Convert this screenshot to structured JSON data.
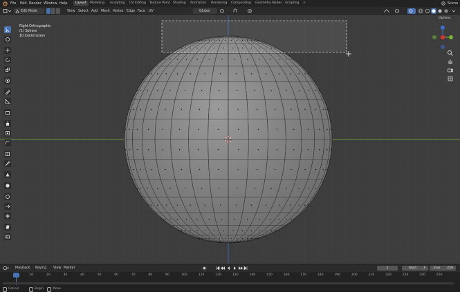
{
  "menu": {
    "items": [
      "File",
      "Edit",
      "Render",
      "Window",
      "Help"
    ]
  },
  "workspaces": {
    "tabs": [
      "Layout",
      "Modeling",
      "Sculpting",
      "UV Editing",
      "Texture Paint",
      "Shading",
      "Animation",
      "Rendering",
      "Compositing",
      "Geometry Nodes",
      "Scripting"
    ],
    "active": "Layout",
    "add": "+",
    "scene": "Scene"
  },
  "editor_header": {
    "mode": "Edit Mode",
    "view": "View",
    "select": "Select",
    "add": "Add",
    "mesh": "Mesh",
    "vertex": "Vertex",
    "edge": "Edge",
    "face": "Face",
    "uv": "UV",
    "transform_orientation": "Global",
    "options": "Options"
  },
  "viewport": {
    "view_name": "Right Orthographic",
    "object": "(1) Sphere",
    "scale": "10 Centimeters",
    "colors": {
      "background": "#3d3d3d",
      "mesh": "#8a8a8a",
      "x_axis": "#79b33a",
      "z_axis": "#3b6fc9"
    }
  },
  "timeline": {
    "playback": "Playback",
    "keying": "Keying",
    "view": "View",
    "marker": "Marker",
    "current_frame": "1",
    "start_label": "Start",
    "start": "1",
    "end_label": "End",
    "end": "250",
    "ticks": [
      "1",
      "10",
      "20",
      "30",
      "40",
      "50",
      "60",
      "70",
      "80",
      "90",
      "100",
      "110",
      "120",
      "130",
      "140",
      "150",
      "160",
      "170",
      "180",
      "190",
      "200",
      "210",
      "220",
      "230",
      "240",
      "250"
    ]
  },
  "statusbar": {
    "cancel": "Cancel",
    "begin": "Begin",
    "move": "Move"
  }
}
